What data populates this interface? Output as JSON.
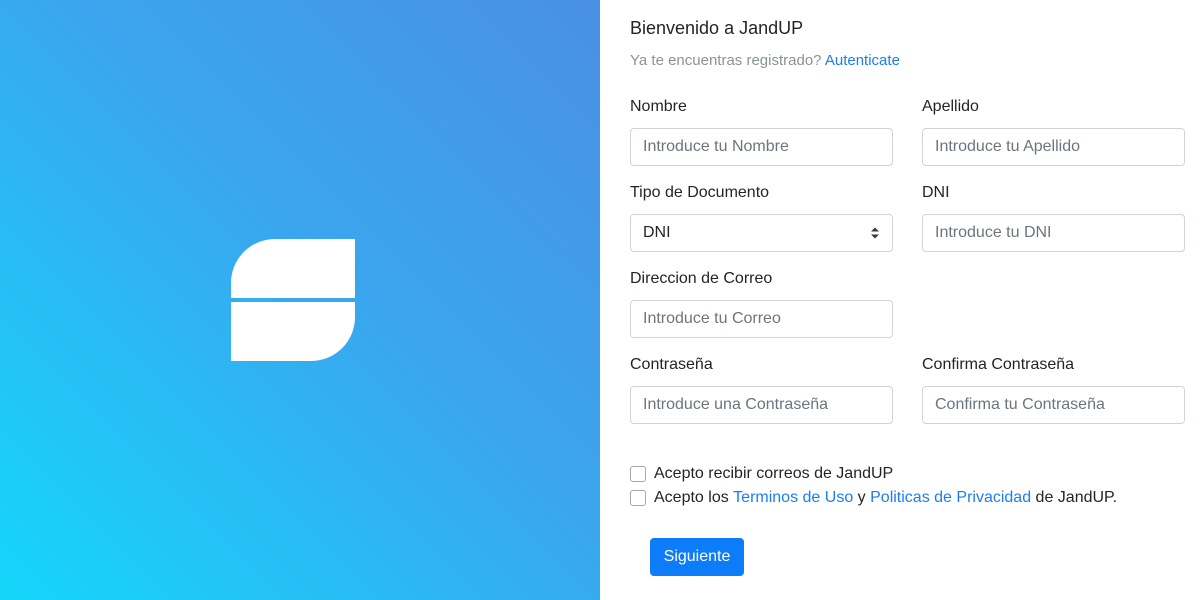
{
  "brand": {
    "logo_icon": "jandup-logo-icon"
  },
  "form": {
    "title": "Bienvenido a JandUP",
    "subtitle_text": "Ya te encuentras registrado?",
    "login_link": "Autenticate",
    "nombre": {
      "label": "Nombre",
      "placeholder": "Introduce tu Nombre"
    },
    "apellido": {
      "label": "Apellido",
      "placeholder": "Introduce tu Apellido"
    },
    "tipo_documento": {
      "label": "Tipo de Documento",
      "value": "DNI"
    },
    "dni": {
      "label": "DNI",
      "placeholder": "Introduce tu DNI"
    },
    "correo": {
      "label": "Direccion de Correo",
      "placeholder": "Introduce tu Correo"
    },
    "password": {
      "label": "Contraseña",
      "placeholder": "Introduce una Contraseña"
    },
    "confirm_password": {
      "label": "Confirma Contraseña",
      "placeholder": "Confirma tu Contraseña"
    },
    "check_emails": {
      "label": "Acepto recibir correos de JandUP",
      "checked": false
    },
    "check_terms": {
      "prefix": "Acepto los",
      "terms_link": "Terminos de Uso",
      "conj": "y",
      "privacy_link": "Politicas de Privacidad",
      "suffix": "de JandUP.",
      "checked": false
    },
    "submit_label": "Siguiente"
  },
  "colors": {
    "accent": "#0d7cf8",
    "link": "#1c7df5",
    "gradient_start": "#14d6fb",
    "gradient_end": "#4a90e2"
  }
}
